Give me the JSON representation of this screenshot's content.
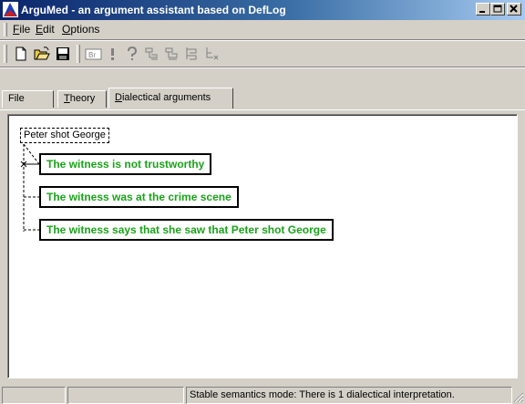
{
  "window": {
    "title": "ArguMed - an argument assistant based on DefLog",
    "icon": "argumed-app-icon",
    "controls": [
      "minimize-icon",
      "maximize-icon",
      "close-icon"
    ]
  },
  "menu": {
    "items": [
      {
        "label_rest": "ile",
        "accel": "F"
      },
      {
        "label_rest": "dit",
        "accel": "E"
      },
      {
        "label_rest": "ptions",
        "accel": "O"
      }
    ]
  },
  "toolbar": {
    "buttons": [
      "new-document-icon",
      "open-folder-icon",
      "save-disk-icon",
      "br-icon",
      "exclamation-icon",
      "question-icon",
      "tree-branch-icon",
      "tree-branch-alt-icon",
      "tree-list-icon",
      "tree-remove-icon"
    ],
    "br_label": "Br"
  },
  "tabs": [
    {
      "label": "File"
    },
    {
      "accel": "T",
      "label_rest": "heory"
    },
    {
      "accel": "D",
      "label_rest": "ialectical arguments",
      "active": true
    }
  ],
  "diagram": {
    "claim": "Peter shot George",
    "reasons": [
      "The witness is not trustworthy",
      "The witness was at the crime scene",
      "The witness says that she saw that Peter shot George"
    ],
    "reason_color": "#1aa31a"
  },
  "status": {
    "panels": [
      "",
      "",
      "Stable semantics mode: There is 1 dialectical interpretation."
    ]
  },
  "colors": {
    "titlebar_start": "#0a246a",
    "titlebar_end": "#a6caf0",
    "face": "#d4d0c8"
  }
}
